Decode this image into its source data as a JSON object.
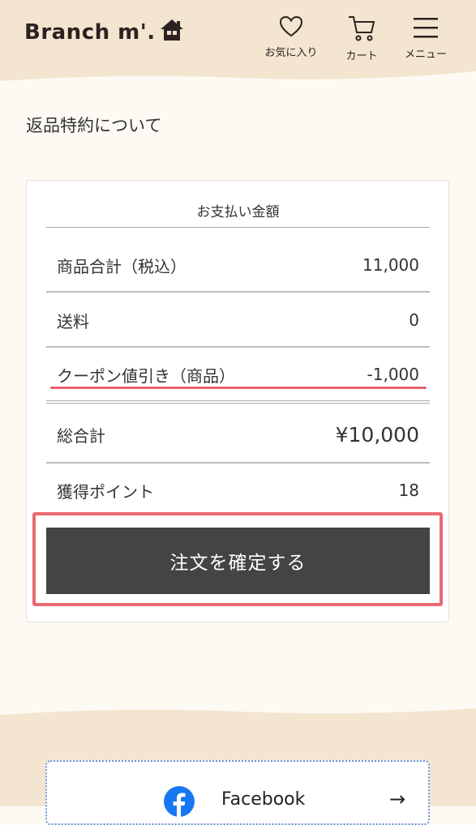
{
  "header": {
    "logo": "Branch m'.",
    "favorites_label": "お気に入り",
    "cart_label": "カート",
    "menu_label": "メニュー"
  },
  "returns_link": "返品特約について",
  "payment": {
    "title": "お支払い金額",
    "subtotal_label": "商品合計（税込）",
    "subtotal_value": "11,000",
    "shipping_label": "送料",
    "shipping_value": "0",
    "coupon_label": "クーポン値引き（商品）",
    "coupon_value": "-1,000",
    "total_label": "総合計",
    "total_value": "¥10,000",
    "points_label": "獲得ポイント",
    "points_value": "18"
  },
  "confirm_button": "注文を確定する",
  "social": {
    "facebook_label": "Facebook",
    "arrow": "→"
  },
  "colors": {
    "header_bg": "#f3e5cf",
    "button_bg": "#444444",
    "highlight": "#ea6a72",
    "facebook_blue": "#1877f2"
  }
}
